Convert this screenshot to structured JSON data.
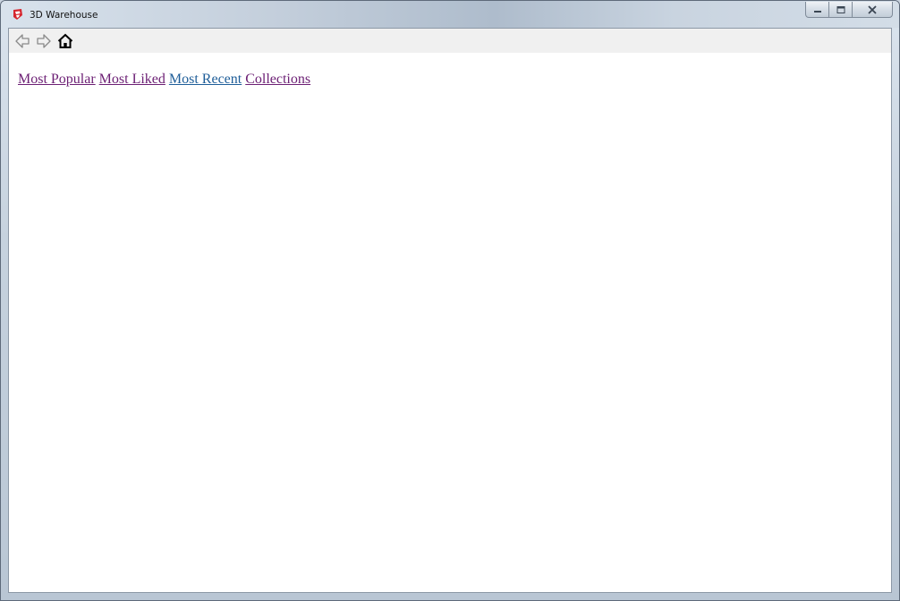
{
  "window": {
    "title": "3D Warehouse"
  },
  "icons": {
    "app": "sketchup-icon",
    "minimize": "minimize-icon",
    "maximize": "maximize-icon",
    "close": "close-icon",
    "back": "arrow-left-icon",
    "forward": "arrow-right-icon",
    "home": "home-icon"
  },
  "nav_links": [
    {
      "label": "Most Popular"
    },
    {
      "label": "Most Liked"
    },
    {
      "label": "Most Recent"
    },
    {
      "label": "Collections"
    }
  ],
  "colors": {
    "visited_link": "#6c1f74",
    "active_link": "#1f5e99",
    "brand_red": "#d6262e"
  }
}
